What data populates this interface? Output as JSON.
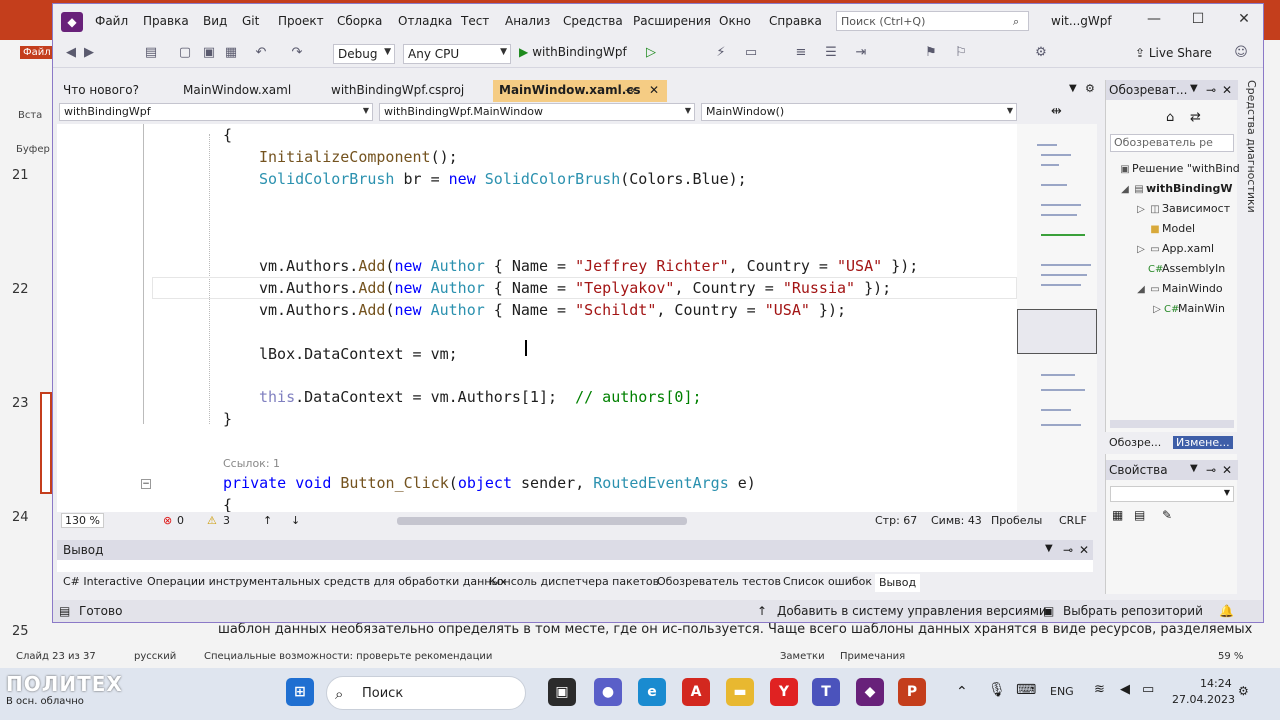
{
  "ppt": {
    "file_tab": "Файл",
    "insert_tab": "Вста",
    "clipboard": "Буфер о",
    "slide_numbers": [
      "21",
      "22",
      "23",
      "24",
      "25"
    ],
    "bottom_text": "шаблон данных необязательно определять в том месте, где он ис-пользуется. Чаще всего шаблоны данных хранятся в виде ресурсов, разделяемых",
    "status": {
      "slide": "Слайд 23 из 37",
      "lang": "русский",
      "accessibility": "Специальные возможности: проверьте рекомендации",
      "notes": "Заметки",
      "comments": "Примечания",
      "zoom": "59 %"
    }
  },
  "watermark": {
    "logo": "ПОЛИТЕХ",
    "weather": "В осн. облачно"
  },
  "taskbar": {
    "search_label": "Поиск",
    "lang": "ENG",
    "time": "14:24",
    "date": "27.04.2023"
  },
  "vs": {
    "menu": [
      "Файл",
      "Правка",
      "Вид",
      "Git",
      "Проект",
      "Сборка",
      "Отладка",
      "Тест",
      "Анализ",
      "Средства",
      "Расширения",
      "Окно",
      "Справка"
    ],
    "search_placeholder": "Поиск (Ctrl+Q)",
    "title": "wit...gWpf",
    "toolbar": {
      "config": "Debug",
      "platform": "Any CPU",
      "run_label": "withBindingWpf",
      "live_share": "Live Share"
    },
    "tabs": [
      {
        "label": "Что нового?",
        "active": false
      },
      {
        "label": "MainWindow.xaml",
        "active": false
      },
      {
        "label": "withBindingWpf.csproj",
        "active": false
      },
      {
        "label": "MainWindow.xaml.cs",
        "active": true
      }
    ],
    "nav": {
      "project": "withBindingWpf",
      "class": "withBindingWpf.MainWindow",
      "member": "MainWindow()"
    },
    "code_lens": "Ссылок: 1",
    "editor_status": {
      "zoom": "130 %",
      "errors": "0",
      "warnings": "3",
      "line": "Стр: 67",
      "col": "Симв: 43",
      "ws": "Пробелы",
      "eol": "CRLF"
    },
    "output": {
      "title": "Вывод"
    },
    "bottom_tabs": [
      "C# Interactive",
      "Операции инструментальных средств для обработки данных",
      "Консоль диспетчера пакетов",
      "Обозреватель тестов",
      "Список ошибок",
      "Вывод"
    ],
    "statusbar": {
      "ready": "Готово",
      "add_vcs": "Добавить в систему управления версиями",
      "repo": "Выбрать репозиторий"
    },
    "solution": {
      "title": "Обозреват...",
      "search": "Обозреватель ре",
      "items": [
        "Решение \"withBind",
        "withBindingW",
        "Зависимост",
        "Model",
        "App.xaml",
        "AssemblyIn",
        "MainWindo",
        "MainWin"
      ],
      "tab1": "Обозре...",
      "tab2": "Измене..."
    },
    "properties": {
      "title": "Свойства"
    },
    "diag_side": "Средства диагностики"
  },
  "code": {
    "l1": "{",
    "l2_m": "InitializeComponent",
    "l2_r": "();",
    "l3_t": "SolidColorBrush",
    "l3_v": " br = ",
    "l3_k": "new",
    "l3_t2": "SolidColorBrush",
    "l3_r": "(Colors.Blue);",
    "a1_pre": "vm.Authors.",
    "a_add": "Add",
    "a_new": "new",
    "a_type": "Author",
    "a1_name": "\"Jeffrey Richter\"",
    "a1_country": "\"USA\"",
    "a2_name": "\"Teplyakov\"",
    "a2_country": "\"Russia\"",
    "a3_name": "\"Schildt\"",
    "a3_country": "\"USA\"",
    "a_mid1": "(",
    "a_mid2": " { Name = ",
    "a_mid3": ", Country = ",
    "a_end": " });",
    "lbox": "lBox.DataContext = vm;",
    "this_kw": "this",
    "this_rest": ".DataContext = vm.Authors[1];  ",
    "this_cm": "// authors[0];",
    "close": "}",
    "m_kw1": "private",
    "m_kw2": "void",
    "m_name": "Button_Click",
    "m_p1": "(",
    "m_kw3": "object",
    "m_p2": " sender, ",
    "m_type": "RoutedEventArgs",
    "m_p3": " e)",
    "open2": "{"
  }
}
